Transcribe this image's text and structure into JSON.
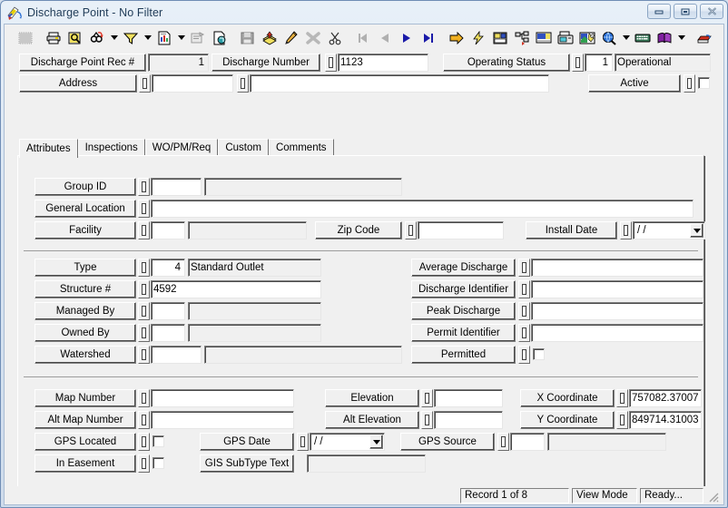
{
  "window": {
    "title": "Discharge Point - No Filter",
    "icon": "discharge-point-app-icon",
    "buttons": {
      "minimize": "minimize",
      "maximize": "maximize",
      "close": "close"
    }
  },
  "toolbar": {
    "items": [
      {
        "name": "grid-view-icon",
        "label": "Grid View",
        "disabled": true
      },
      {
        "name": "print-icon",
        "label": "Print"
      },
      {
        "name": "print-preview-icon",
        "label": "Print Preview"
      },
      {
        "name": "find-icon",
        "label": "Find",
        "dropdown": true
      },
      {
        "name": "filter-icon",
        "label": "Filter",
        "dropdown": true
      },
      {
        "name": "report-icon",
        "label": "Report",
        "dropdown": true
      },
      {
        "name": "form-edit-icon",
        "label": "Form Properties",
        "disabled": true
      },
      {
        "name": "copy-record-icon",
        "label": "Copy Record"
      },
      {
        "name": "save-icon",
        "label": "Save",
        "disabled": true
      },
      {
        "name": "add-record-icon",
        "label": "Add Record"
      },
      {
        "name": "edit-record-icon",
        "label": "Edit Record"
      },
      {
        "name": "delete-record-icon",
        "label": "Delete Record",
        "disabled": true
      },
      {
        "name": "cut-icon",
        "label": "Cut"
      },
      {
        "name": "first-record-icon",
        "label": "First Record",
        "disabled": true
      },
      {
        "name": "previous-record-icon",
        "label": "Previous Record",
        "disabled": true
      },
      {
        "name": "next-record-icon",
        "label": "Next Record"
      },
      {
        "name": "last-record-icon",
        "label": "Last Record"
      },
      {
        "name": "goto-icon",
        "label": "Go To"
      },
      {
        "name": "lightning-icon",
        "label": "Quick Action"
      },
      {
        "name": "layout-icon",
        "label": "Layout"
      },
      {
        "name": "tree-view-icon",
        "label": "Tree View"
      },
      {
        "name": "monitor-icon",
        "label": "Monitor"
      },
      {
        "name": "fax-icon",
        "label": "Fax"
      },
      {
        "name": "image-edit-icon",
        "label": "Image Editor"
      },
      {
        "name": "globe-search-icon",
        "label": "GIS Search",
        "dropdown": true
      },
      {
        "name": "keyboard-icon",
        "label": "Keyboard Entry"
      },
      {
        "name": "help-book-icon",
        "label": "Help",
        "dropdown": true
      },
      {
        "name": "exit-icon",
        "label": "Exit"
      }
    ]
  },
  "header": {
    "rec_label": "Discharge Point Rec #",
    "rec_value": "1",
    "discharge_number_label": "Discharge Number",
    "discharge_number_value": "1123",
    "operating_status_label": "Operating Status",
    "operating_status_code": "1",
    "operating_status_desc": "Operational",
    "address_label": "Address",
    "address_value_1": "",
    "address_value_2": "",
    "active_label": "Active",
    "active_checked": false
  },
  "tabs": [
    {
      "label": "Attributes",
      "active": true
    },
    {
      "label": "Inspections",
      "active": false
    },
    {
      "label": "WO/PM/Req",
      "active": false
    },
    {
      "label": "Custom",
      "active": false
    },
    {
      "label": "Comments",
      "active": false
    }
  ],
  "attributes": {
    "group1": [
      {
        "name": "group-id",
        "label": "Group ID",
        "code": "",
        "desc": ""
      },
      {
        "name": "general-location",
        "label": "General Location",
        "value": ""
      },
      {
        "name": "facility",
        "label": "Facility",
        "code": "",
        "desc": ""
      },
      {
        "name": "zip-code",
        "label": "Zip Code",
        "value": ""
      },
      {
        "name": "install-date",
        "label": "Install Date",
        "value": "  /  /"
      }
    ],
    "group2_left": [
      {
        "name": "type",
        "label": "Type",
        "code": "4",
        "desc": "Standard Outlet"
      },
      {
        "name": "structure-number",
        "label": "Structure #",
        "value": "4592"
      },
      {
        "name": "managed-by",
        "label": "Managed By",
        "code": "",
        "desc": ""
      },
      {
        "name": "owned-by",
        "label": "Owned By",
        "code": "",
        "desc": ""
      },
      {
        "name": "watershed",
        "label": "Watershed",
        "code": "",
        "desc": ""
      }
    ],
    "group2_right": [
      {
        "name": "average-discharge",
        "label": "Average Discharge",
        "value": ""
      },
      {
        "name": "discharge-identifier",
        "label": "Discharge Identifier",
        "value": ""
      },
      {
        "name": "peak-discharge",
        "label": "Peak Discharge",
        "value": ""
      },
      {
        "name": "permit-identifier",
        "label": "Permit Identifier",
        "value": ""
      },
      {
        "name": "permitted",
        "label": "Permitted",
        "checked": false
      }
    ],
    "group3_left": [
      {
        "name": "map-number",
        "label": "Map Number",
        "value": ""
      },
      {
        "name": "alt-map-number",
        "label": "Alt Map Number",
        "value": ""
      },
      {
        "name": "gps-located",
        "label": "GPS Located",
        "checked": false
      },
      {
        "name": "in-easement",
        "label": "In Easement",
        "checked": false
      }
    ],
    "group3_mid": [
      {
        "name": "gps-date",
        "label": "GPS Date",
        "value": "  /  /"
      },
      {
        "name": "gis-subtype-text",
        "label": "GIS SubType Text",
        "value": ""
      }
    ],
    "group3_right": [
      {
        "name": "elevation",
        "label": "Elevation",
        "value": ""
      },
      {
        "name": "alt-elevation",
        "label": "Alt Elevation",
        "value": ""
      },
      {
        "name": "x-coordinate",
        "label": "X Coordinate",
        "value": "757082.37007"
      },
      {
        "name": "y-coordinate",
        "label": "Y Coordinate",
        "value": "849714.31003"
      },
      {
        "name": "gps-source",
        "label": "GPS Source",
        "code": "",
        "desc": ""
      }
    ]
  },
  "statusbar": {
    "record": "Record 1 of 8",
    "mode": "View Mode",
    "state": "Ready..."
  },
  "colors": {
    "face": "#f0f0f0",
    "titlebar_text": "#1f3b57",
    "frame": "#6f8db5"
  }
}
